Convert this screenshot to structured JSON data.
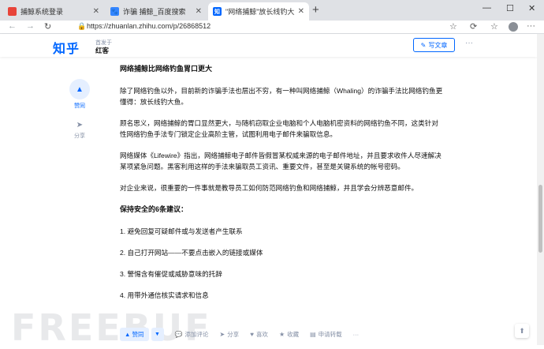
{
  "browser": {
    "tabs": [
      {
        "title": "捕鲸系统登录",
        "icon_color": "#e8443a",
        "icon_glyph": ""
      },
      {
        "title": "诈骗 捕鲸_百度搜索",
        "icon_color": "#3385ff",
        "icon_glyph": "🐾"
      },
      {
        "title": "\"网络捕鲸\"放长线钓大鱼，谷歌和",
        "icon_color": "#0066ff",
        "icon_glyph": "知"
      }
    ],
    "url": "https://zhuanlan.zhihu.com/p/26868512"
  },
  "header": {
    "logo": "知乎",
    "published_in": "首发于",
    "column_name": "红客",
    "write_button": "写文章",
    "more": "···"
  },
  "sidebar": {
    "vote_label": "赞同",
    "share_label": "分享"
  },
  "article": {
    "heading": "网络捕鲸比网络钓鱼胃口更大",
    "paragraphs": [
      "除了网络钓鱼以外，目前新的诈骗手法也层出不穷，有一种叫网络捕鲸（Whaling）的诈骗手法比网络钓鱼更懂得：放长线钓大鱼。",
      "顾名思义，网络捕鲸的胃口显然更大，与随机窃取企业电脑和个人电脑机密资料的网络钓鱼不同，这类针对性网络钓鱼手法专门锁定企业高阶主管，试图利用电子邮件来骗取信息。",
      "网络媒体《Lifewire》指出，网络捕鲸电子邮件皆假冒某权威来源的电子邮件地址，并且要求收件人尽速解决某项紧急问题。黑客利用这样的手法来骗取员工资讯、重要文件，甚至是关键系统的帐号密码。",
      "对企业来说，很重要的一件事就是教导员工如何防范网络钓鱼和网络捕鲸，并且学会分辨恶意邮件。"
    ],
    "subheading": "保持安全的6条建议：",
    "tips": [
      "1. 避免回复可疑邮件或与发送者产生联系",
      "2. 自己打开网站——不要点击嵌入的链接或媒体",
      "3. 警惕含有催促或威胁意味的托辞",
      "4. 用带外通信核实请求和信息"
    ]
  },
  "actions": {
    "upvote": "▲ 赞同",
    "comment": "添加评论",
    "share": "分享",
    "like": "喜欢",
    "collect": "收藏",
    "reprint": "申请转载"
  },
  "watermark": "FREEBUF"
}
